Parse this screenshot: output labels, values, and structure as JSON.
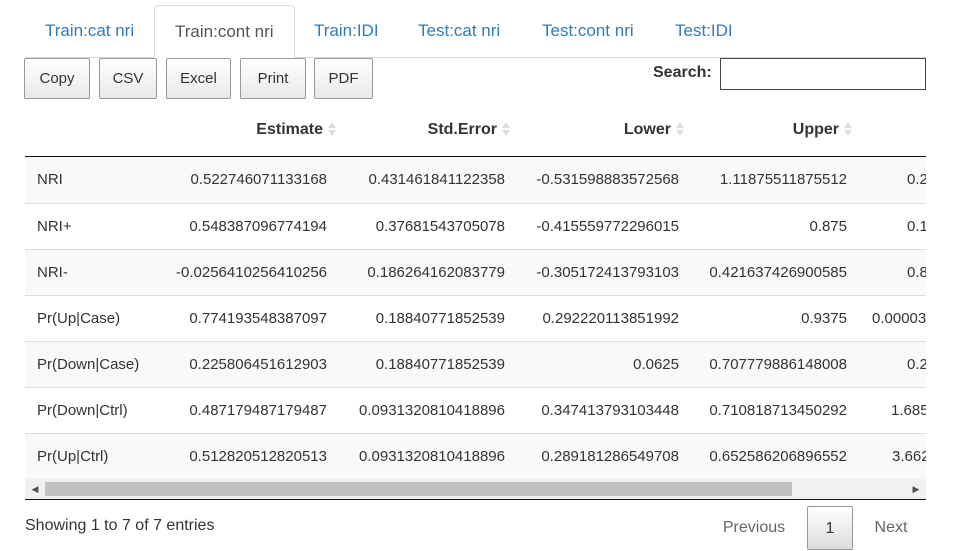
{
  "tabs": [
    {
      "label": "Train:cat nri",
      "active": false
    },
    {
      "label": "Train:cont nri",
      "active": true
    },
    {
      "label": "Train:IDI",
      "active": false
    },
    {
      "label": "Test:cat nri",
      "active": false
    },
    {
      "label": "Test:cont nri",
      "active": false
    },
    {
      "label": "Test:IDI",
      "active": false
    }
  ],
  "buttons": {
    "copy": "Copy",
    "csv": "CSV",
    "excel": "Excel",
    "print": "Print",
    "pdf": "PDF"
  },
  "search": {
    "label": "Search:",
    "value": ""
  },
  "table": {
    "columns": [
      "",
      "Estimate",
      "Std.Error",
      "Lower",
      "Upper",
      ""
    ],
    "rows": [
      [
        "NRI",
        "0.522746071133168",
        "0.431461841122358",
        "-0.531598883572568",
        "1.11875511875512",
        "0.2"
      ],
      [
        "NRI+",
        "0.548387096774194",
        "0.37681543705078",
        "-0.415559772296015",
        "0.875",
        "0.1"
      ],
      [
        "NRI-",
        "-0.0256410256410256",
        "0.186264162083779",
        "-0.305172413793103",
        "0.421637426900585",
        "0.8"
      ],
      [
        "Pr(Up|Case)",
        "0.774193548387097",
        "0.18840771852539",
        "0.292220113851992",
        "0.9375",
        "0.00003"
      ],
      [
        "Pr(Down|Case)",
        "0.225806451612903",
        "0.18840771852539",
        "0.0625",
        "0.707779886148008",
        "0.2"
      ],
      [
        "Pr(Down|Ctrl)",
        "0.487179487179487",
        "0.0931320810418896",
        "0.347413793103448",
        "0.710818713450292",
        "1.685"
      ],
      [
        "Pr(Up|Ctrl)",
        "0.512820512820513",
        "0.0931320810418896",
        "0.289181286549708",
        "0.652586206896552",
        "3.662"
      ]
    ]
  },
  "footer": {
    "info": "Showing 1 to 7 of 7 entries",
    "previous": "Previous",
    "page": "1",
    "next": "Next"
  },
  "scrollbar": {
    "left_icon": "arrow-left-icon",
    "right_icon": "arrow-right-icon"
  },
  "colors": {
    "link": "#337ab7",
    "active_tab_text": "#555555",
    "stripe": "#f9f9f9"
  }
}
